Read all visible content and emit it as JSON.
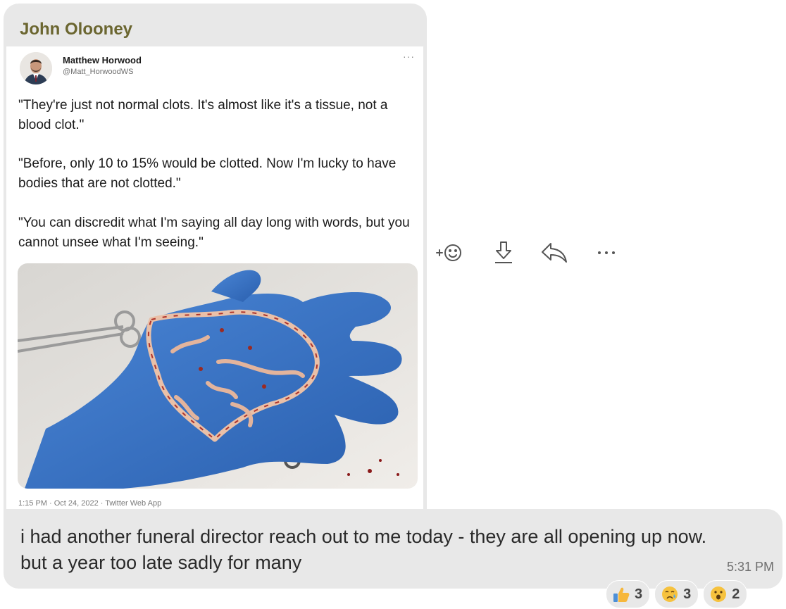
{
  "message": {
    "sender": "John Olooney",
    "text": "i had another funeral director reach out to me today - they are all opening up now.\nbut a year too late sadly for many",
    "time": "5:31 PM"
  },
  "tweet": {
    "author_name": "Matthew Horwood",
    "author_handle": "@Matt_HorwoodWS",
    "more_label": "···",
    "paragraphs": [
      "\"They're just not normal clots. It's almost like it's a tissue, not a blood clot.\"",
      "\"Before, only 10 to 15% would be clotted. Now I'm lucky to have bodies that are not clotted.\"",
      "\"You can discredit what I'm saying all day long with words, but you cannot unsee what I'm seeing.\""
    ],
    "footer": "1:15 PM · Oct 24, 2022 · Twitter Web App"
  },
  "actions": {
    "react_icon": "add-reaction-icon",
    "download_icon": "download-icon",
    "reply_icon": "reply-icon",
    "more_icon": "more-icon"
  },
  "reactions": [
    {
      "emoji": "thumbs-up",
      "count": "3"
    },
    {
      "emoji": "crying-face",
      "count": "3"
    },
    {
      "emoji": "surprised-face",
      "count": "2"
    }
  ],
  "colors": {
    "bubble": "#e8e8e8",
    "sender_name": "#6b6630",
    "glove": "#3a73c4"
  }
}
